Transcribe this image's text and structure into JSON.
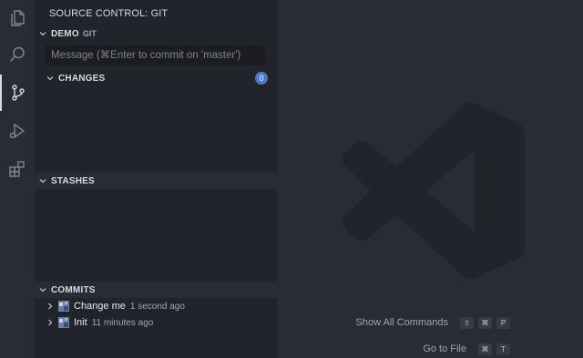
{
  "sidebar": {
    "title": "SOURCE CONTROL: GIT",
    "repo": {
      "name": "DEMO",
      "provider": "GIT"
    },
    "commit_input": {
      "placeholder": "Message (⌘Enter to commit on 'master')",
      "value": ""
    },
    "changes": {
      "title": "CHANGES",
      "count": "0"
    },
    "stashes": {
      "title": "STASHES"
    },
    "commits": {
      "title": "COMMITS",
      "items": [
        {
          "message": "Change me",
          "time": "1 second ago"
        },
        {
          "message": "Init",
          "time": "11 minutes ago"
        }
      ]
    }
  },
  "activity_bar": {
    "items": [
      "explorer-icon",
      "search-icon",
      "source-control-icon",
      "run-debug-icon",
      "extensions-icon"
    ],
    "active": "source-control-icon"
  },
  "editor": {
    "shortcuts": [
      {
        "label": "Show All Commands",
        "keys": [
          "⇧",
          "⌘",
          "P"
        ]
      },
      {
        "label": "Go to File",
        "keys": [
          "⌘",
          "T"
        ]
      }
    ]
  },
  "colors": {
    "accent": "#4d78cc",
    "sidebar_bg": "#21252b",
    "editor_bg": "#282c34"
  }
}
